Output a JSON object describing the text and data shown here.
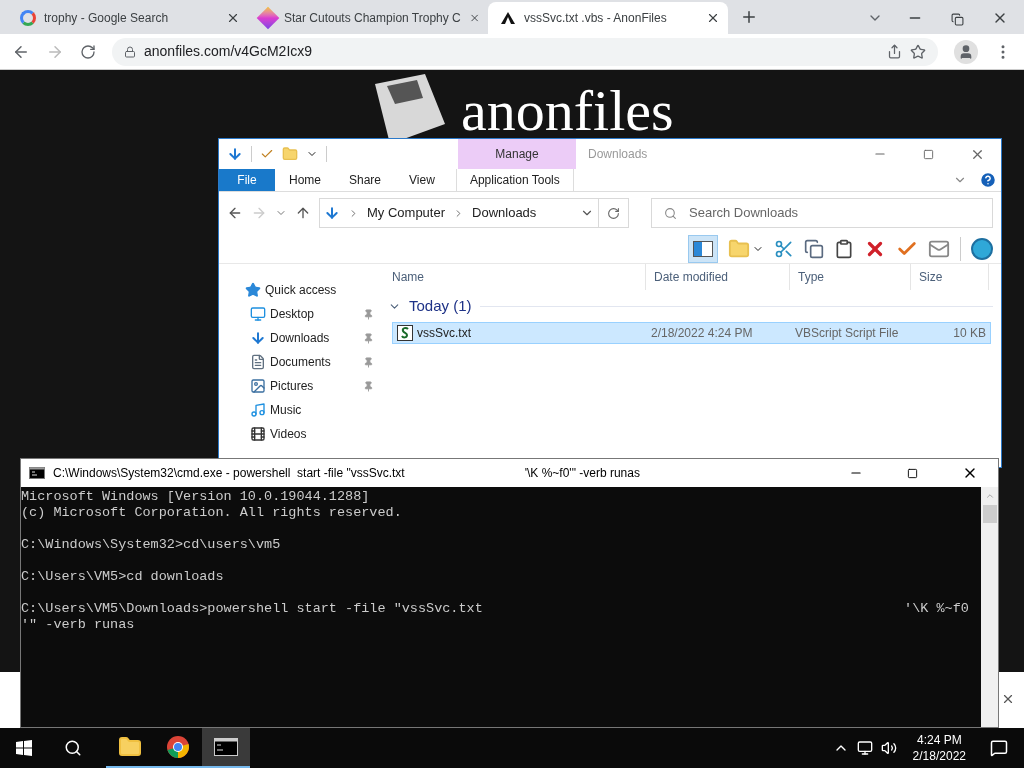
{
  "browser": {
    "tabs": [
      {
        "title": "trophy - Google Search",
        "kind": "google",
        "selected": false
      },
      {
        "title": "Star Cutouts Champion Trophy C",
        "kind": "shop",
        "selected": false
      },
      {
        "title": "vssSvc.txt .vbs - AnonFiles",
        "kind": "anon",
        "selected": true
      }
    ],
    "url": "anonfiles.com/v4GcM2Icx9"
  },
  "page": {
    "logo": "anonfiles"
  },
  "explorer": {
    "title": "Downloads",
    "context_group": "Manage",
    "ribbon_tabs": [
      {
        "label": "File",
        "kind": "file"
      },
      {
        "label": "Home",
        "kind": "tab"
      },
      {
        "label": "Share",
        "kind": "tab"
      },
      {
        "label": "View",
        "kind": "tab"
      },
      {
        "label": "Application Tools",
        "kind": "context"
      }
    ],
    "breadcrumb": [
      "My Computer",
      "Downloads"
    ],
    "search": {
      "placeholder": "Search Downloads"
    },
    "nav": [
      {
        "label": "Quick access",
        "kind": "star",
        "pinned": false
      },
      {
        "label": "Desktop",
        "kind": "desktop",
        "pinned": true
      },
      {
        "label": "Downloads",
        "kind": "download",
        "pinned": true
      },
      {
        "label": "Documents",
        "kind": "document",
        "pinned": true
      },
      {
        "label": "Pictures",
        "kind": "picture",
        "pinned": true
      },
      {
        "label": "Music",
        "kind": "music",
        "pinned": false
      },
      {
        "label": "Videos",
        "kind": "video",
        "pinned": false
      }
    ],
    "columns": [
      "Name",
      "Date modified",
      "Type",
      "Size"
    ],
    "group": "Today (1)",
    "files": [
      {
        "name": "vssSvc.txt",
        "date": "2/18/2022 4:24 PM",
        "type": "VBScript Script File",
        "size": "10 KB",
        "selected": true
      }
    ]
  },
  "cmd": {
    "title": "C:\\Windows\\System32\\cmd.exe - powershell  start -file \"vssSvc.txt                                    '\\K %~f0'\" -verb runas",
    "blocks": [
      [
        "Microsoft Windows [Version 10.0.19044.1288]",
        "(c) Microsoft Corporation. All rights reserved."
      ],
      [
        "C:\\Windows\\System32>cd\\users\\vm5"
      ],
      [
        "C:\\Users\\VM5>cd downloads"
      ],
      [
        "C:\\Users\\VM5\\Downloads>powershell start -file \"vssSvc.txt                                                    '\\K %~f0",
        "'\" -verb runas"
      ]
    ]
  },
  "taskbar": {
    "apps": [
      {
        "kind": "explorer",
        "running": true,
        "active": false
      },
      {
        "kind": "chrome",
        "running": true,
        "active": false
      },
      {
        "kind": "terminal",
        "running": true,
        "active": true
      }
    ],
    "time": "4:24 PM",
    "date": "2/18/2022"
  }
}
